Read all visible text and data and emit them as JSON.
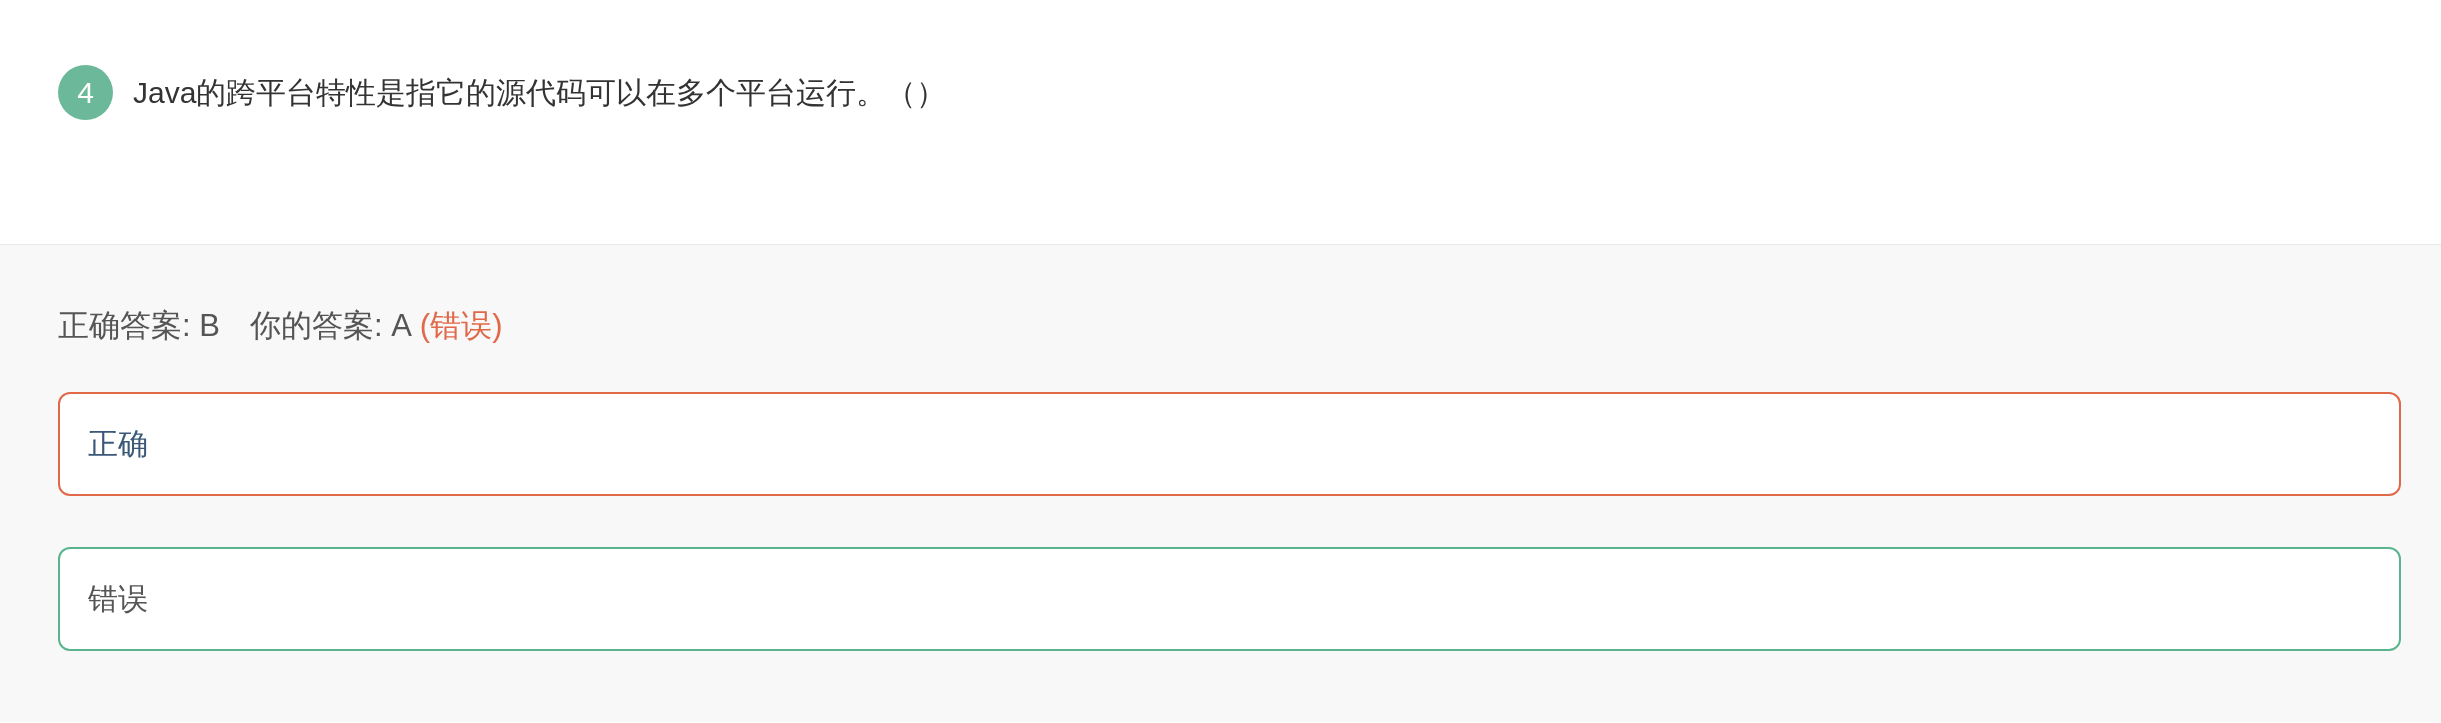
{
  "question": {
    "number": "4",
    "text": "Java的跨平台特性是指它的源代码可以在多个平台运行。（）"
  },
  "result": {
    "correct_answer": "正确答案: B",
    "your_answer": "你的答案: A",
    "verdict": "(错误)"
  },
  "options": [
    {
      "label": "正确",
      "selected": true,
      "correct": false
    },
    {
      "label": "错误",
      "selected": false,
      "correct": true
    }
  ]
}
